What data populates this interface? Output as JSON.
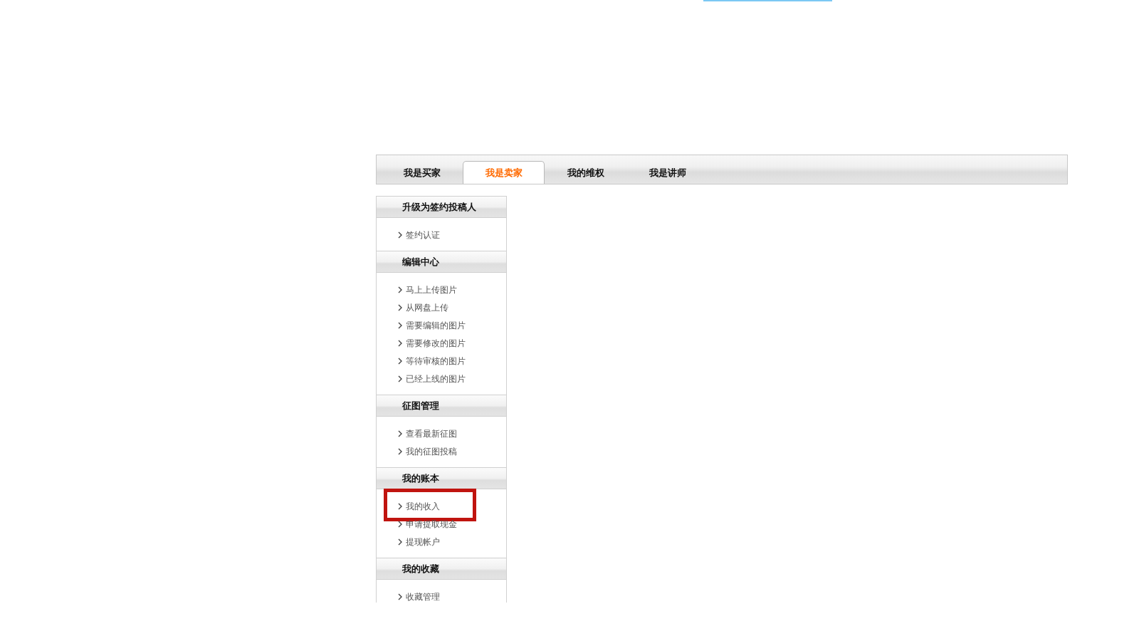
{
  "tabs": [
    {
      "label": "我是买家",
      "selected": false
    },
    {
      "label": "我是卖家",
      "selected": true
    },
    {
      "label": "我的维权",
      "selected": false
    },
    {
      "label": "我是讲师",
      "selected": false
    }
  ],
  "sidebar": {
    "sections": [
      {
        "title": "升级为签约投稿人",
        "items": [
          {
            "label": "签约认证",
            "highlighted": false
          }
        ]
      },
      {
        "title": "编辑中心",
        "items": [
          {
            "label": "马上上传图片",
            "highlighted": false
          },
          {
            "label": "从网盘上传",
            "highlighted": false
          },
          {
            "label": "需要编辑的图片",
            "highlighted": false
          },
          {
            "label": "需要修改的图片",
            "highlighted": false
          },
          {
            "label": "等待审核的图片",
            "highlighted": false
          },
          {
            "label": "已经上线的图片",
            "highlighted": false
          }
        ]
      },
      {
        "title": "征图管理",
        "items": [
          {
            "label": "查看最新征图",
            "highlighted": false
          },
          {
            "label": "我的征图投稿",
            "highlighted": false
          }
        ]
      },
      {
        "title": "我的账本",
        "items": [
          {
            "label": "我的收入",
            "highlighted": true
          },
          {
            "label": "申请提取现金",
            "highlighted": false
          },
          {
            "label": "提现帐户",
            "highlighted": false
          }
        ]
      },
      {
        "title": "我的收藏",
        "items": [
          {
            "label": "收藏管理",
            "highlighted": false
          }
        ]
      }
    ]
  }
}
